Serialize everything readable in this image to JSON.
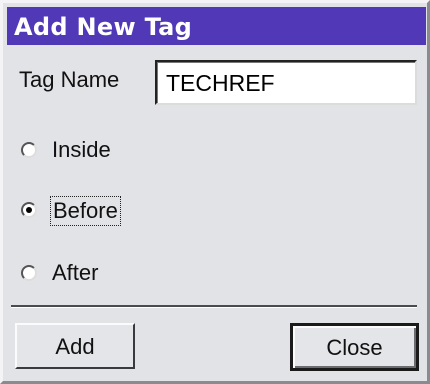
{
  "window": {
    "title": "Add New Tag"
  },
  "tag_name": {
    "label": "Tag Name",
    "value": "TECHREF"
  },
  "position_options": [
    {
      "label": "Inside",
      "selected": false
    },
    {
      "label": "Before",
      "selected": true
    },
    {
      "label": "After",
      "selected": false
    }
  ],
  "buttons": {
    "add_label": "Add",
    "close_label": "Close"
  },
  "colors": {
    "titlebar": "#5138b6",
    "dialog_bg": "#e2e3e7"
  }
}
